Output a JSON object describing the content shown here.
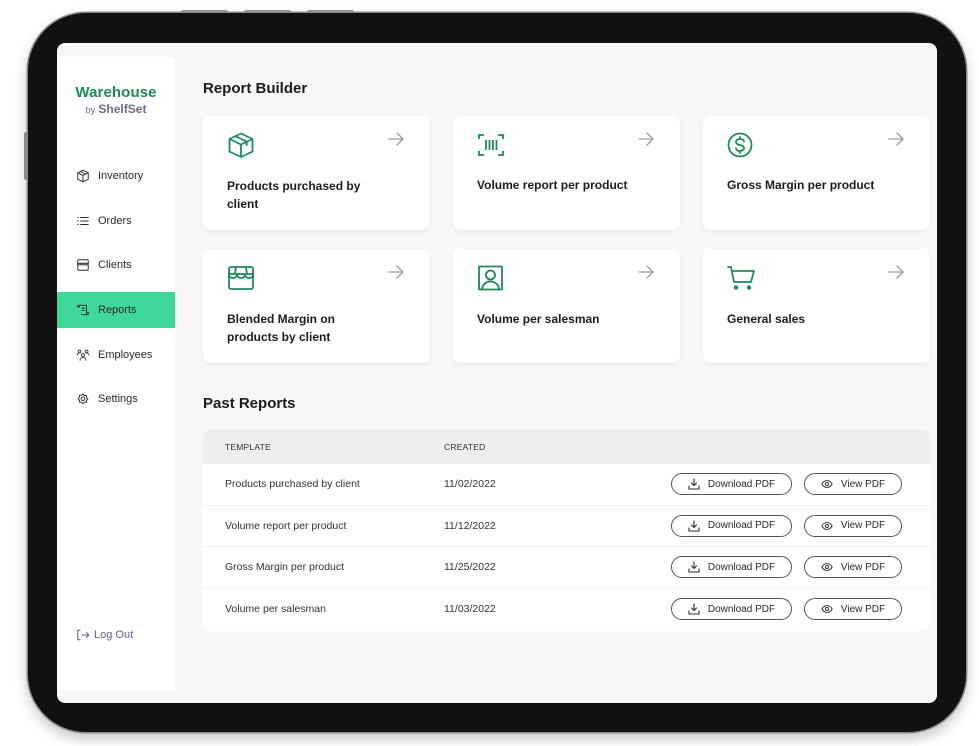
{
  "brand": {
    "name": "Warehouse",
    "sub_prefix": "by",
    "sub_name": "ShelfSet",
    "color": "#1e8a55"
  },
  "sidebar": {
    "items": [
      {
        "label": "Inventory",
        "icon": "box-icon",
        "active": false
      },
      {
        "label": "Orders",
        "icon": "list-icon",
        "active": false
      },
      {
        "label": "Clients",
        "icon": "store-icon",
        "active": false
      },
      {
        "label": "Reports",
        "icon": "scroll-icon",
        "active": true
      },
      {
        "label": "Employees",
        "icon": "people-icon",
        "active": false
      },
      {
        "label": "Settings",
        "icon": "gear-icon",
        "active": false
      }
    ],
    "active_color": "#3fd899",
    "logout_label": "Log Out"
  },
  "report_builder": {
    "title": "Report Builder",
    "cards": [
      {
        "label": "Products purchased by client",
        "icon": "box-icon"
      },
      {
        "label": "Volume report per product",
        "icon": "barcode-icon"
      },
      {
        "label": "Gross Margin per product",
        "icon": "dollar-icon"
      },
      {
        "label": "Blended Margin on products by client",
        "icon": "store-icon"
      },
      {
        "label": "Volume per salesman",
        "icon": "user-icon"
      },
      {
        "label": "General sales",
        "icon": "cart-icon"
      }
    ],
    "icon_color": "#1e8a55"
  },
  "past_reports": {
    "title": "Past Reports",
    "columns": [
      "TEMPLATE",
      "CREATED"
    ],
    "download_label": "Download PDF",
    "view_label": "View PDF",
    "rows": [
      {
        "template": "Products purchased by client",
        "created": "11/02/2022"
      },
      {
        "template": "Volume report per product",
        "created": "11/12/2022"
      },
      {
        "template": "Gross Margin per product",
        "created": "11/25/2022"
      },
      {
        "template": "Volume per salesman",
        "created": "11/03/2022"
      }
    ]
  }
}
